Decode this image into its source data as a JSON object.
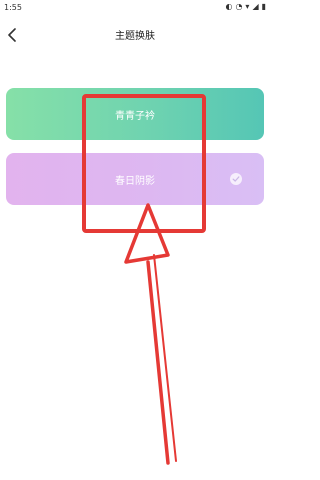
{
  "status_bar": {
    "time": "1:55"
  },
  "header": {
    "title": "主题换肤"
  },
  "themes": [
    {
      "label": "青青子衿",
      "selected": false,
      "color_start": "#86e0a8",
      "color_end": "#55c6b5"
    },
    {
      "label": "春日阴影",
      "selected": true,
      "color_start": "#e2b3ee",
      "color_end": "#d9bff5"
    }
  ],
  "annotation": {
    "color": "#e53935"
  }
}
